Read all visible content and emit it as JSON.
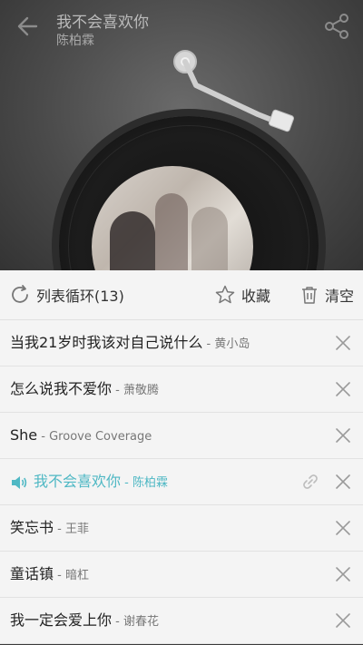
{
  "header": {
    "title": "我不会喜欢你",
    "artist": "陈柏霖"
  },
  "toolbar": {
    "loop_label": "列表循环(13)",
    "favorite_label": "收藏",
    "clear_label": "清空"
  },
  "playlist": [
    {
      "song": "当我21岁时我该对自己说什么",
      "singer": "黄小岛"
    },
    {
      "song": "怎么说我不爱你",
      "singer": "萧敬腾"
    },
    {
      "song": "She",
      "singer": "Groove Coverage"
    },
    {
      "song": "我不会喜欢你",
      "singer": "陈柏霖",
      "playing": true
    },
    {
      "song": "笑忘书",
      "singer": "王菲"
    },
    {
      "song": "童话镇",
      "singer": "暗杠"
    },
    {
      "song": "我一定会爱上你",
      "singer": "谢春花"
    }
  ],
  "separator": " - ",
  "colors": {
    "accent": "#4fb8c4",
    "panel_bg": "#f4f4f4"
  },
  "icons": {
    "back": "arrow-left-icon",
    "share": "share-icon",
    "loop": "loop-icon",
    "favorite": "star-icon",
    "clear": "trash-icon",
    "remove": "close-icon",
    "link": "link-icon",
    "playing": "speaker-icon"
  }
}
